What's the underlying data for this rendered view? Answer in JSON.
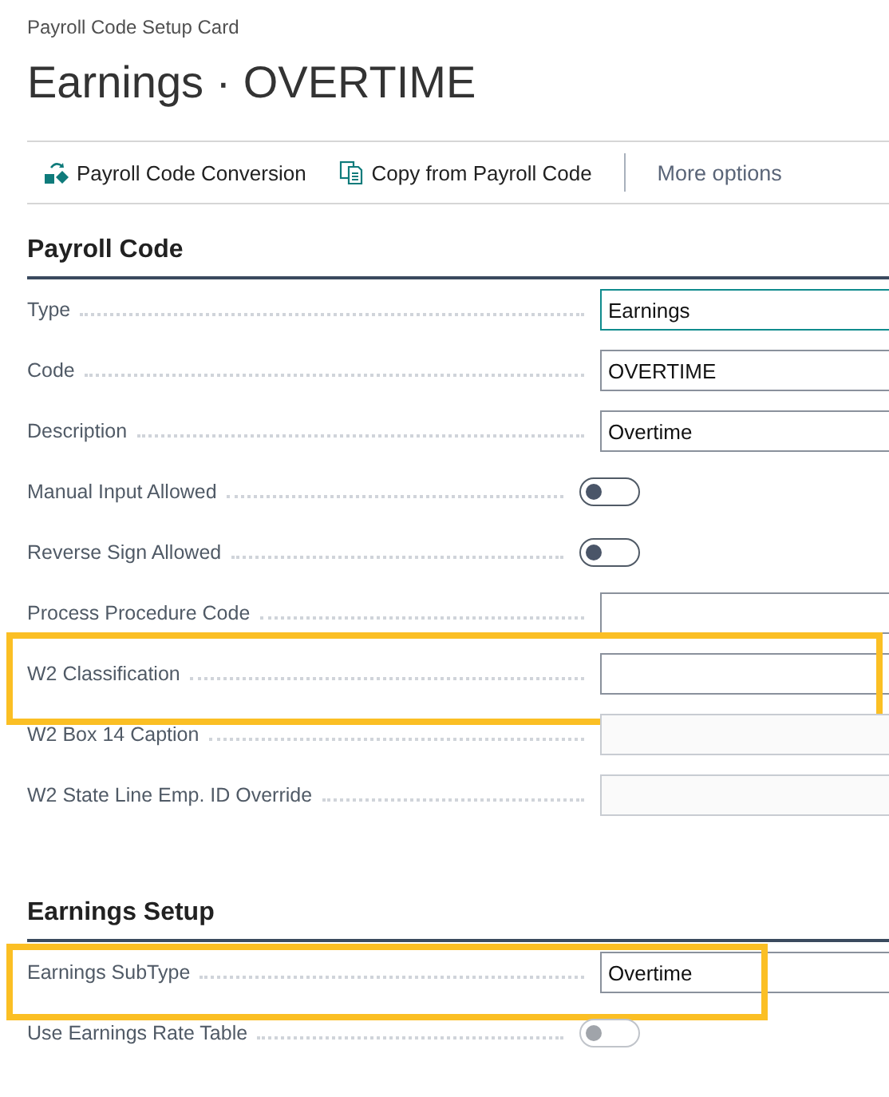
{
  "breadcrumb": "Payroll Code Setup Card",
  "title": "Earnings · OVERTIME",
  "actions": [
    {
      "label": "Payroll Code Conversion",
      "kind": "convert"
    },
    {
      "label": "Copy from Payroll Code",
      "kind": "copy"
    }
  ],
  "more_options": "More options",
  "sections": [
    {
      "title": "Payroll Code",
      "fields": [
        {
          "label": "Type",
          "kind": "text",
          "value": "Earnings",
          "focused": true,
          "disabled": false
        },
        {
          "label": "Code",
          "kind": "text",
          "value": "OVERTIME",
          "focused": false,
          "disabled": false
        },
        {
          "label": "Description",
          "kind": "text",
          "value": "Overtime",
          "focused": false,
          "disabled": false
        },
        {
          "label": "Manual Input Allowed",
          "kind": "toggle",
          "on": false,
          "disabled": false
        },
        {
          "label": "Reverse Sign Allowed",
          "kind": "toggle",
          "on": false,
          "disabled": false
        },
        {
          "label": "Process Procedure Code",
          "kind": "text",
          "focused": false,
          "disabled": false
        },
        {
          "label": "W2 Classification",
          "kind": "text",
          "focused": false,
          "disabled": false,
          "highlighted": true
        },
        {
          "label": "W2 Box 14 Caption",
          "kind": "text",
          "focused": false,
          "disabled": true
        },
        {
          "label": "W2 State Line Emp. ID Override",
          "kind": "text",
          "focused": false,
          "disabled": true
        }
      ]
    },
    {
      "title": "Earnings Setup",
      "fields": [
        {
          "label": "Earnings SubType",
          "kind": "text",
          "value": "Overtime",
          "focused": false,
          "disabled": false,
          "highlighted": true
        },
        {
          "label": "Use Earnings Rate Table",
          "kind": "toggle",
          "on": false,
          "disabled": true
        }
      ]
    }
  ]
}
